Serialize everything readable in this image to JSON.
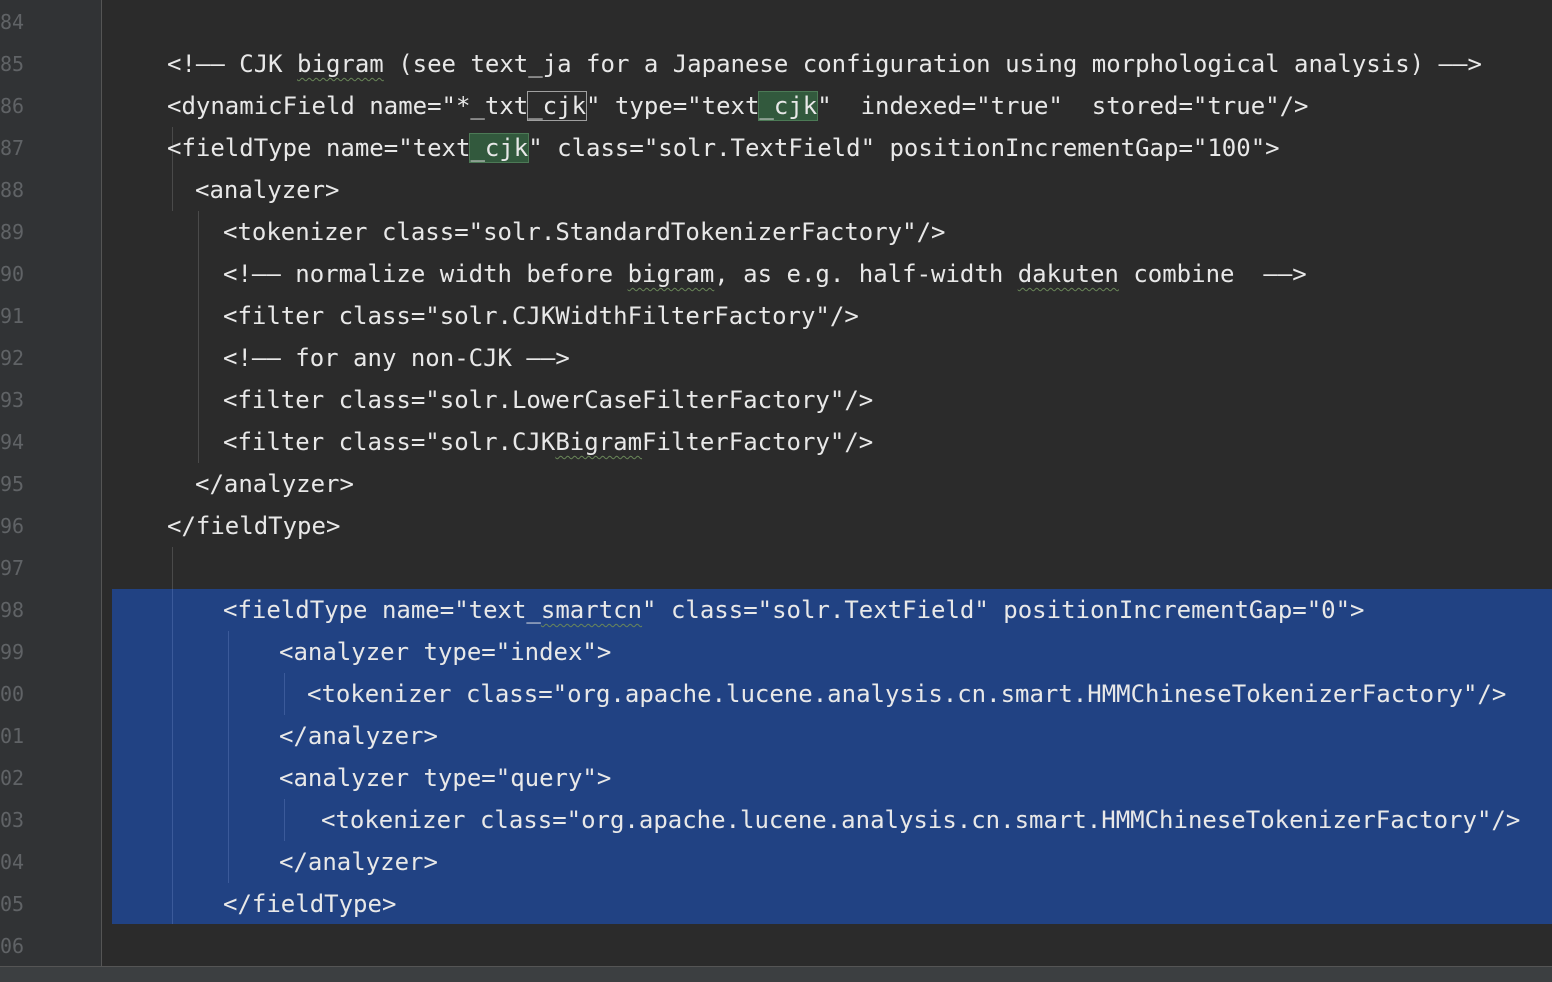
{
  "editor": {
    "line_numbers": [
      "84",
      "85",
      "86",
      "87",
      "88",
      "89",
      "90",
      "91",
      "92",
      "93",
      "94",
      "95",
      "96",
      "97",
      "98",
      "99",
      "00",
      "01",
      "02",
      "03",
      "04",
      "05",
      "06"
    ],
    "lines": {
      "l85": [
        "<!—— CJK ",
        "bigram",
        " (see text_ja for a Japanese configuration using morphological analysis) ——>"
      ],
      "l86": [
        "<dynamicField name=\"*_txt",
        "_cjk",
        "\" type=\"text",
        "_cjk",
        "\"  indexed=\"true\"  stored=\"true\"/>"
      ],
      "l87": [
        "<fieldType name=\"text",
        "_cjk",
        "\" class=\"solr.TextField\" positionIncrementGap=\"100\">"
      ],
      "l88": "<analyzer>",
      "l89": "<tokenizer class=\"solr.StandardTokenizerFactory\"/>",
      "l90": [
        "<!—— normalize width before ",
        "bigram",
        ", as e.g. half-width ",
        "dakuten",
        " combine  ——>"
      ],
      "l91": "<filter class=\"solr.CJKWidthFilterFactory\"/>",
      "l92": "<!—— for any non-CJK ——>",
      "l93": "<filter class=\"solr.LowerCaseFilterFactory\"/>",
      "l94": [
        "<filter class=\"solr.CJK",
        "Bigram",
        "FilterFactory\"/>"
      ],
      "l95": "</analyzer>",
      "l96": "</fieldType>",
      "l98": [
        "<fieldType name=\"text_",
        "smartcn",
        "\" class=\"solr.TextField\" positionIncrementGap=\"0\">"
      ],
      "l99": "<analyzer type=\"index\">",
      "l100": "<tokenizer class=\"org.apache.lucene.analysis.cn.smart.HMMChineseTokenizerFactory\"/>",
      "l101": "</analyzer>",
      "l102": "<analyzer type=\"query\">",
      "l103": "<tokenizer class=\"org.apache.lucene.analysis.cn.smart.HMMChineseTokenizerFactory\"/>",
      "l104": "</analyzer>",
      "l105": "</fieldType>"
    },
    "colors": {
      "background": "#2b2b2b",
      "gutter": "#313335",
      "line_number": "#606366",
      "text": "#e8e8e8",
      "selection": "#214283",
      "identifier_highlight": "#32593d",
      "typo_squiggle": "#6a8759"
    }
  }
}
